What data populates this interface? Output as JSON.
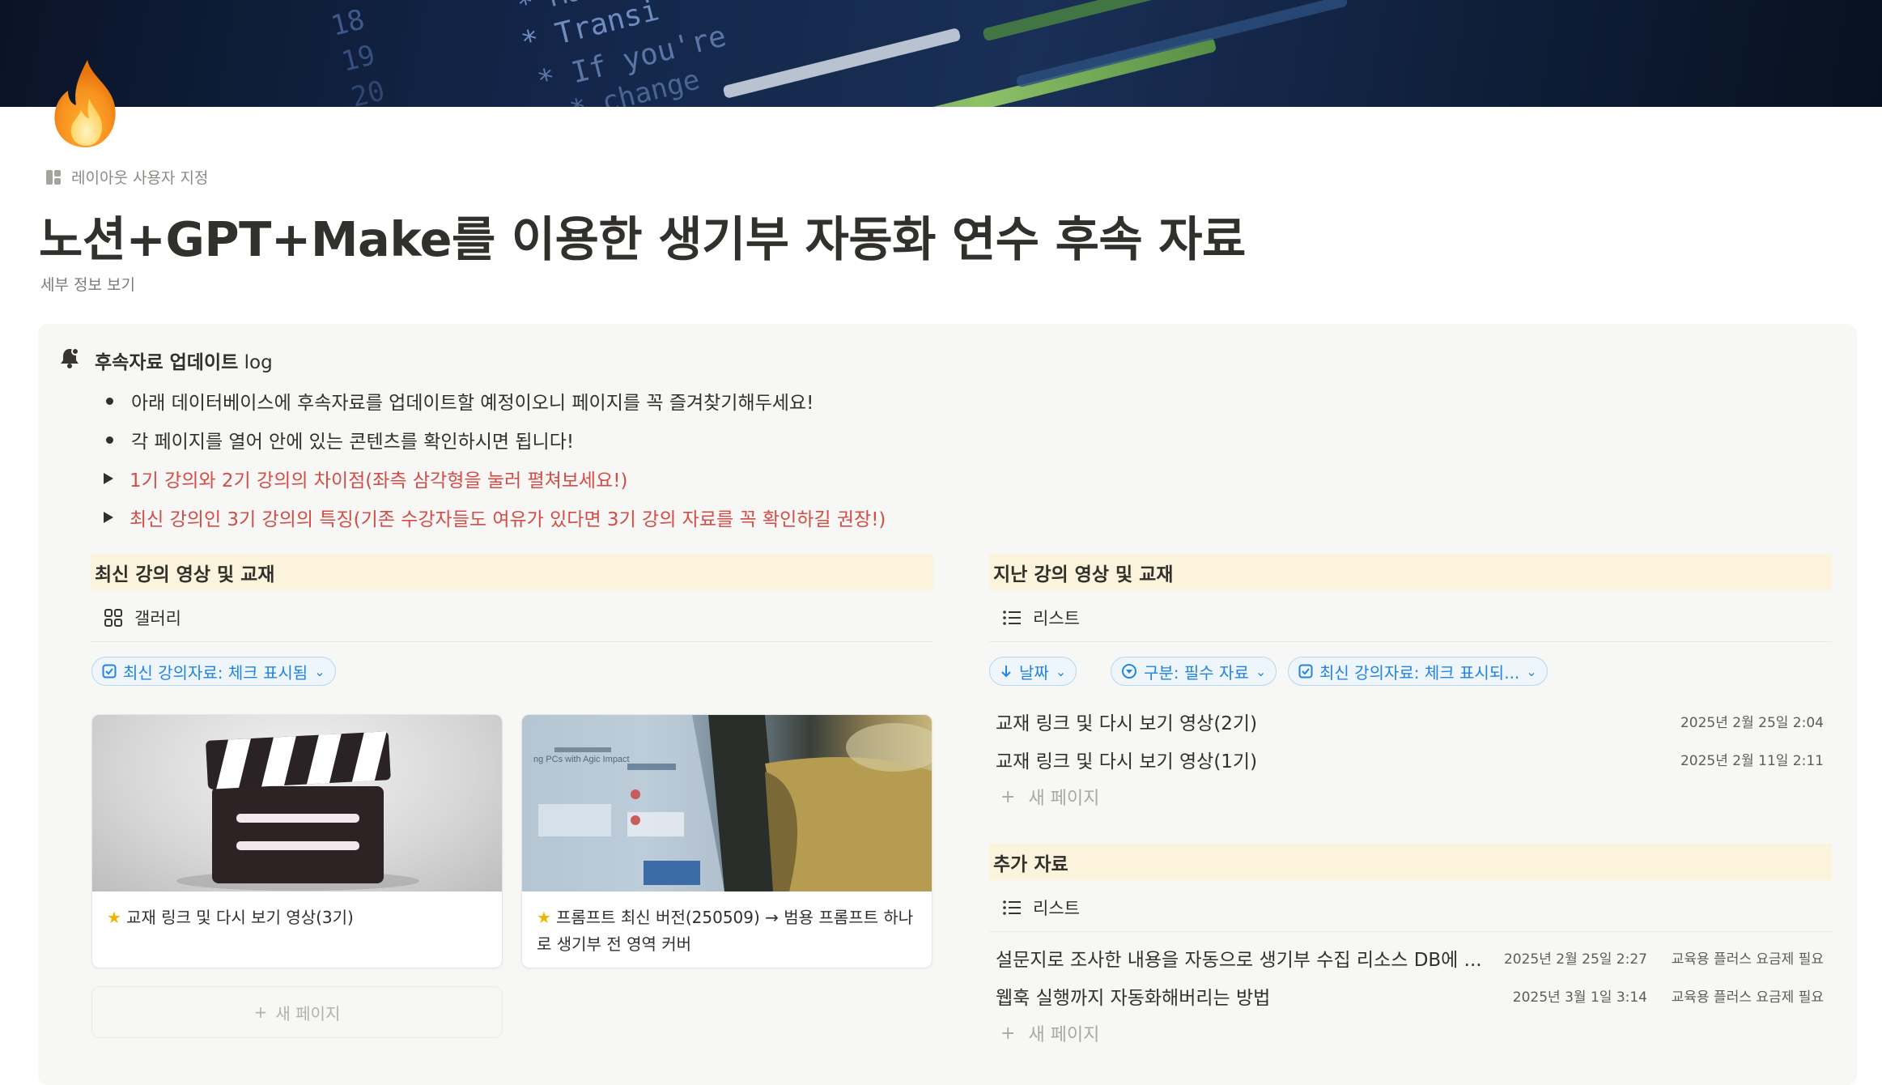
{
  "page": {
    "layout_label": "레이아웃 사용자 지정",
    "title": "노션+GPT+Make를 이용한 생기부 자동화 연수 후속 자료",
    "details_label": "세부 정보 보기"
  },
  "callout": {
    "title": "후속자료 업데이트",
    "title_suffix": " log",
    "bullets": [
      "아래 데이터베이스에 후속자료를 업데이트할 예정이오니 페이지를 꼭 즐겨찾기해두세요!",
      "각 페이지를 열어 안에 있는 콘텐츠를 확인하시면 됩니다!"
    ],
    "toggles": [
      "1기 강의와 2기 강의의 차이점(좌측 삼각형을 눌러 펼쳐보세요!)",
      "최신 강의인 3기 강의의 특징(기존 수강자들도 여유가 있다면 3기 강의 자료를 꼭 확인하길 권장!)"
    ]
  },
  "latest": {
    "header": "최신 강의 영상 및 교재",
    "view_label": "갤러리",
    "filter_chip": "최신 강의자료: 체크 표시됨",
    "cards": [
      {
        "title": "교재 링크 및 다시 보기 영상(3기)"
      },
      {
        "title": "프롬프트 최신 버전(250509) → 범용 프롬프트 하나로 생기부 전 영역 커버"
      }
    ],
    "new_page": "새 페이지",
    "card_thumb_text": "ng PCs with Agic Impact"
  },
  "past": {
    "header": "지난 강의 영상 및 교재",
    "view_label": "리스트",
    "chips": [
      "날짜",
      "구분: 필수 자료",
      "최신 강의자료: 체크 표시되..."
    ],
    "rows": [
      {
        "title": "교재 링크 및 다시 보기 영상(2기)",
        "date": "2025년 2월 25일 2:04"
      },
      {
        "title": "교재 링크 및 다시 보기 영상(1기)",
        "date": "2025년 2월 11일 2:11"
      }
    ],
    "new_page": "새 페이지"
  },
  "extra": {
    "header": "추가 자료",
    "view_label": "리스트",
    "rows": [
      {
        "title": "설문지로 조사한 내용을 자동으로 생기부 수집 리소스 DB에 ...",
        "date": "2025년 2월 25일 2:27",
        "tag": "교육용 플러스 요금제 필요"
      },
      {
        "title": "웹훅 실행까지 자동화해버리는 방법",
        "date": "2025년 3월 1일 3:14",
        "tag": "교육용 플러스 요금제 필요"
      }
    ],
    "new_page": "새 페이지"
  },
  "cover": {
    "code_lines": [
      "18",
      "19",
      "20",
      "* Transi",
      "* If you're",
      "* change",
      "* Make"
    ]
  },
  "colors": {
    "accent_blue": "#2383e2",
    "red_text": "#d44c47",
    "header_bg": "#fbf3db",
    "callout_bg": "#f7f7f5"
  },
  "icons": {
    "page": "fire-emoji-icon",
    "callout": "bell-icon",
    "layout": "layout-icon",
    "gallery": "gallery-icon",
    "list": "list-icon",
    "checkbox": "checkbox-icon",
    "arrow": "arrow-down-icon",
    "select": "select-icon",
    "chevron": "chevron-down-icon",
    "plus": "plus-icon",
    "star": "star-icon"
  }
}
